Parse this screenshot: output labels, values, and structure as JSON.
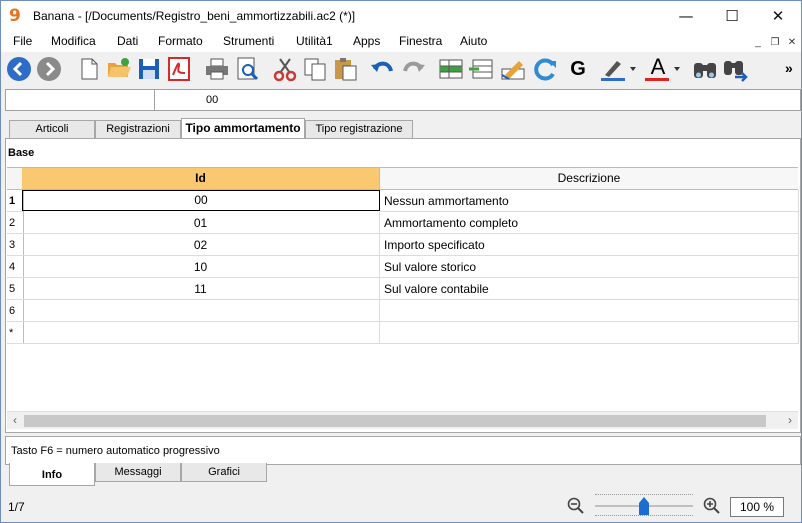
{
  "window": {
    "app_logo": "9",
    "title": "Banana - [/Documents/Registro_beni_ammortizzabili.ac2 (*)]",
    "min_glyph": "—",
    "max_glyph": "☐",
    "close_glyph": "✕"
  },
  "menu": {
    "items": [
      "File",
      "Modifica",
      "Dati",
      "Formato",
      "Strumenti",
      "Utilità1",
      "Apps",
      "Finestra",
      "Aiuto"
    ],
    "mdi_min": "_",
    "mdi_restore": "❐",
    "mdi_close": "✕",
    "overflow": "»"
  },
  "toolbar": {
    "bold_label": "G",
    "font_color_label": "A",
    "colors": {
      "blue_nav": "#2f6cc7",
      "gray_nav": "#8a8a8a",
      "red_pdf": "#d12b2b",
      "cut": "#c83a3a",
      "orange_folder": "#e7a33b",
      "accent_blue": "#1c5fb8",
      "font_red": "#e0231e",
      "highlight_blue": "#2f6cc7"
    }
  },
  "cell_address": {
    "left_value": "",
    "value": "00"
  },
  "tabs": [
    "Articoli",
    "Registrazioni",
    "Tipo ammortamento",
    "Tipo registrazione"
  ],
  "active_tab": "Tipo ammortamento",
  "section_title": "Base",
  "table": {
    "headers": {
      "id": "Id",
      "description": "Descrizione"
    },
    "header_active_color": "#f9c870",
    "rows": [
      {
        "num": "1",
        "id": "00",
        "description": "Nessun ammortamento"
      },
      {
        "num": "2",
        "id": "01",
        "description": "Ammortamento completo"
      },
      {
        "num": "3",
        "id": "02",
        "description": "Importo specificato"
      },
      {
        "num": "4",
        "id": "10",
        "description": "Sul valore storico"
      },
      {
        "num": "5",
        "id": "11",
        "description": "Sul valore contabile"
      },
      {
        "num": "6",
        "id": "",
        "description": ""
      },
      {
        "num": "*",
        "id": "",
        "description": ""
      }
    ]
  },
  "scrollbar": {
    "left_arrow": "‹",
    "right_arrow": "›"
  },
  "info_text": "Tasto F6 = numero automatico progressivo",
  "bottom_tabs": [
    "Info",
    "Messaggi",
    "Grafici"
  ],
  "active_bottom_tab": "Info",
  "status": {
    "page": "1/7",
    "zoom": "100 %",
    "zoom_level_percent": 100
  }
}
